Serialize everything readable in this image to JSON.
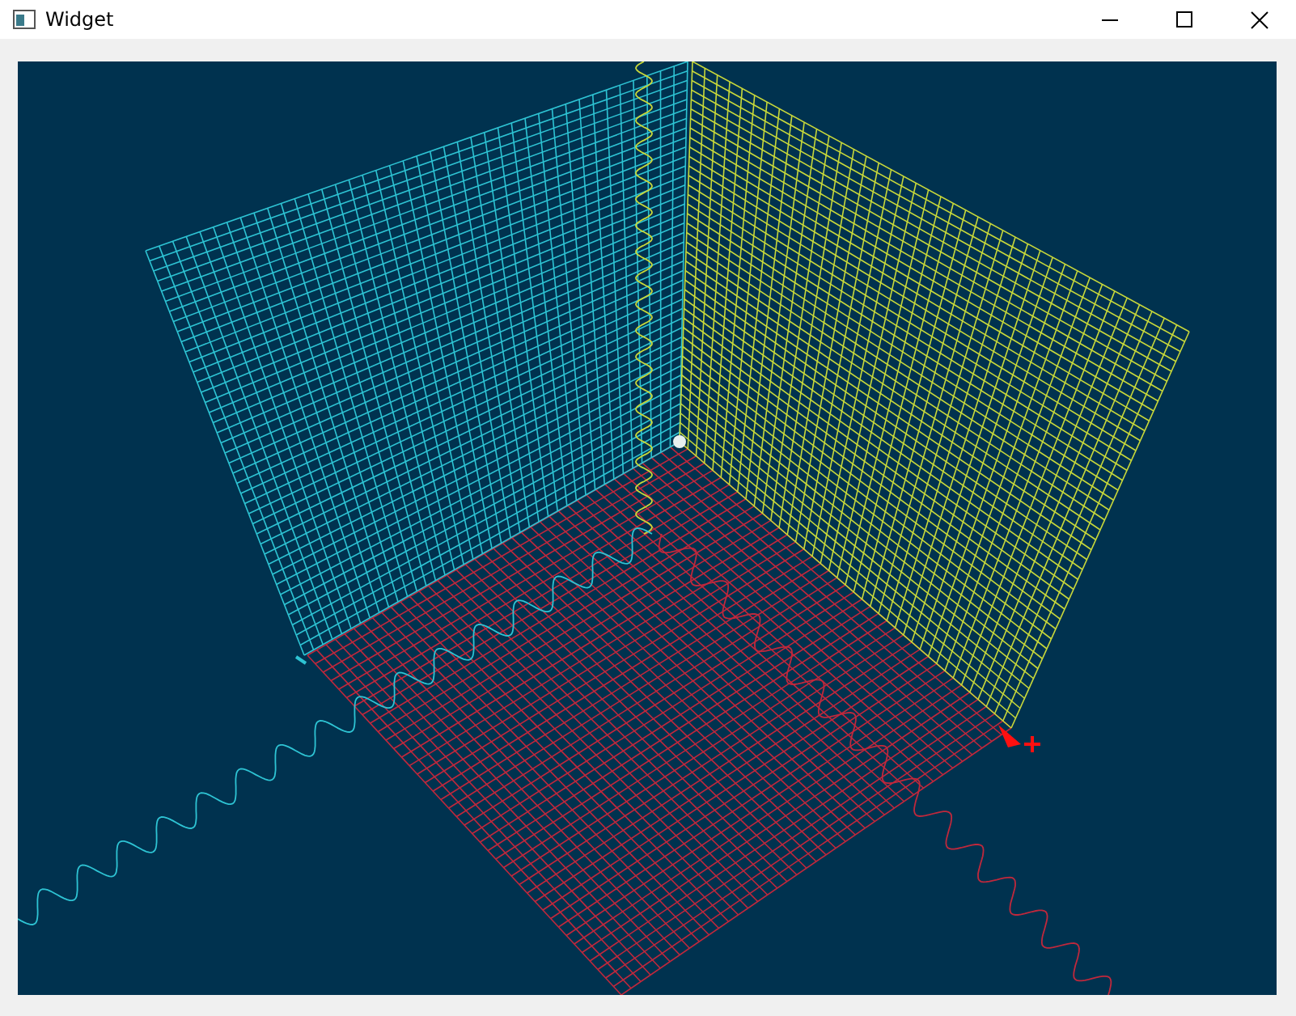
{
  "window": {
    "title": "Widget"
  }
}
